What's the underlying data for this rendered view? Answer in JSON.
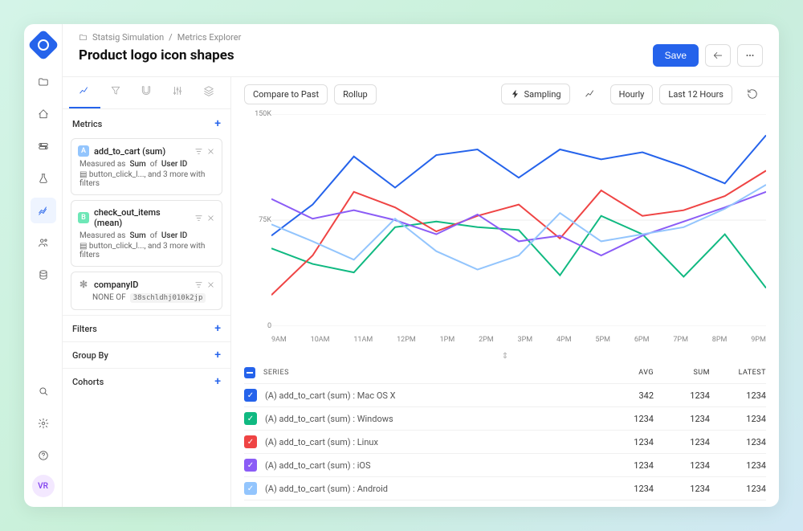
{
  "breadcrumb": {
    "icon": "folder",
    "crumbs": [
      "Statsig Simulation",
      "Metrics Explorer"
    ]
  },
  "page_title": "Product logo icon shapes",
  "avatar_initials": "VR",
  "toolbar": {
    "save_label": "Save",
    "back_aria": "Back",
    "more_aria": "More"
  },
  "sidebar": {
    "tabs": [
      "chart",
      "filter",
      "retention",
      "bars",
      "compare"
    ],
    "metrics_label": "Metrics",
    "cards": [
      {
        "badge": "A",
        "badge_color": "#93c5fd",
        "title": "add_to_cart (sum)",
        "measured_prefix": "Measured as",
        "agg": "Sum",
        "of": "of",
        "dim": "User ID",
        "detail_prefix": "button_click_l...",
        "detail_suffix": ", and 3 more with filters"
      },
      {
        "badge": "B",
        "badge_color": "#6ee7b7",
        "title": "check_out_items (mean)",
        "measured_prefix": "Measured as",
        "agg": "Sum",
        "of": "of",
        "dim": "User ID",
        "detail_prefix": "button_click_l...",
        "detail_suffix": ", and 3 more with filters"
      },
      {
        "badge": "*",
        "badge_color": "transparent",
        "title": "companyID",
        "is_symbol": true,
        "none_of_label": "NONE OF",
        "tag": "38schldhj010k2jp"
      }
    ],
    "sections": [
      "Filters",
      "Group By",
      "Cohorts"
    ]
  },
  "chartbar": {
    "compare_label": "Compare to Past",
    "rollup_label": "Rollup",
    "sampling_label": "Sampling",
    "granularity_label": "Hourly",
    "range_label": "Last 12 Hours"
  },
  "chart_data": {
    "type": "line",
    "ylim": [
      0,
      150000
    ],
    "yticks": [
      {
        "v": 0,
        "label": "0"
      },
      {
        "v": 75000,
        "label": "75K"
      },
      {
        "v": 150000,
        "label": "150K"
      }
    ],
    "xticks": [
      "9AM",
      "10AM",
      "11AM",
      "12PM",
      "1PM",
      "2PM",
      "3PM",
      "4PM",
      "5PM",
      "6PM",
      "7PM",
      "8PM",
      "9PM"
    ],
    "series": [
      {
        "name": "(A) add_to_cart (sum) : Mac OS X",
        "color": "#2563eb",
        "values": [
          64000,
          86000,
          120000,
          98000,
          121000,
          125000,
          105000,
          125000,
          118000,
          123000,
          113000,
          101000,
          135000
        ]
      },
      {
        "name": "(A) add_to_cart (sum) : Windows",
        "color": "#10b981",
        "values": [
          55000,
          44000,
          38000,
          70000,
          74000,
          70000,
          68000,
          36000,
          78000,
          65000,
          35000,
          65000,
          27000
        ]
      },
      {
        "name": "(A) add_to_cart (sum) : Linux",
        "color": "#ef4444",
        "values": [
          22000,
          50000,
          95000,
          84000,
          67000,
          78000,
          86000,
          62000,
          96000,
          78000,
          82000,
          92000,
          110000
        ]
      },
      {
        "name": "(A) add_to_cart (sum) : iOS",
        "color": "#8b5cf6",
        "values": [
          90000,
          76000,
          82000,
          75000,
          65000,
          79000,
          60000,
          64000,
          50000,
          64000,
          74000,
          84000,
          95000
        ]
      },
      {
        "name": "(A) add_to_cart (sum) : Android",
        "color": "#93c5fd",
        "values": [
          72000,
          60000,
          47000,
          76000,
          53000,
          40000,
          50000,
          80000,
          60000,
          65000,
          70000,
          83000,
          100000
        ]
      }
    ]
  },
  "table": {
    "headers": {
      "series": "SERIES",
      "avg": "AVG",
      "sum": "SUM",
      "latest": "LATEST"
    },
    "rows": [
      {
        "color": "#2563eb",
        "name": "(A) add_to_cart (sum) : Mac OS X",
        "avg": "342",
        "sum": "1234",
        "latest": "1234"
      },
      {
        "color": "#10b981",
        "name": "(A) add_to_cart (sum) : Windows",
        "avg": "1234",
        "sum": "1234",
        "latest": "1234"
      },
      {
        "color": "#ef4444",
        "name": "(A) add_to_cart (sum) : Linux",
        "avg": "1234",
        "sum": "1234",
        "latest": "1234"
      },
      {
        "color": "#8b5cf6",
        "name": "(A) add_to_cart (sum) : iOS",
        "avg": "1234",
        "sum": "1234",
        "latest": "1234"
      },
      {
        "color": "#93c5fd",
        "name": "(A) add_to_cart (sum) : Android",
        "avg": "1234",
        "sum": "1234",
        "latest": "1234"
      }
    ]
  }
}
